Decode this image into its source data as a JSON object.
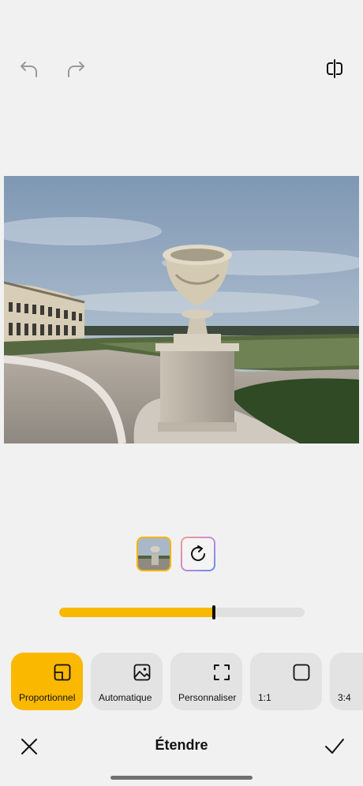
{
  "toolbar": {
    "undo_icon": "undo-arrow-icon",
    "redo_icon": "redo-arrow-icon",
    "compare_icon": "compare-split-icon"
  },
  "editor": {
    "image": "garden-urn-photo",
    "thumbnail_icon": "photo-thumbnail",
    "reset_icon": "rotate-reset-icon",
    "slider": {
      "value": 0.63,
      "fill_color": "#F9B800"
    }
  },
  "modes": [
    {
      "label": "Proportionnel",
      "icon": "proportional-icon",
      "selected": true
    },
    {
      "label": "Automatique",
      "icon": "image-icon",
      "selected": false
    },
    {
      "label": "Personnaliser",
      "icon": "custom-frame-icon",
      "selected": false
    },
    {
      "label": "1:1",
      "icon": "square-icon",
      "selected": false
    },
    {
      "label": "3:4",
      "icon": "rect-icon",
      "selected": false
    }
  ],
  "bottom_bar": {
    "title": "Étendre",
    "cancel_icon": "close-icon",
    "confirm_icon": "check-icon"
  },
  "colors": {
    "accent": "#F9B800",
    "background": "#F1F1F1",
    "chip_inactive": "#E3E3E3"
  }
}
